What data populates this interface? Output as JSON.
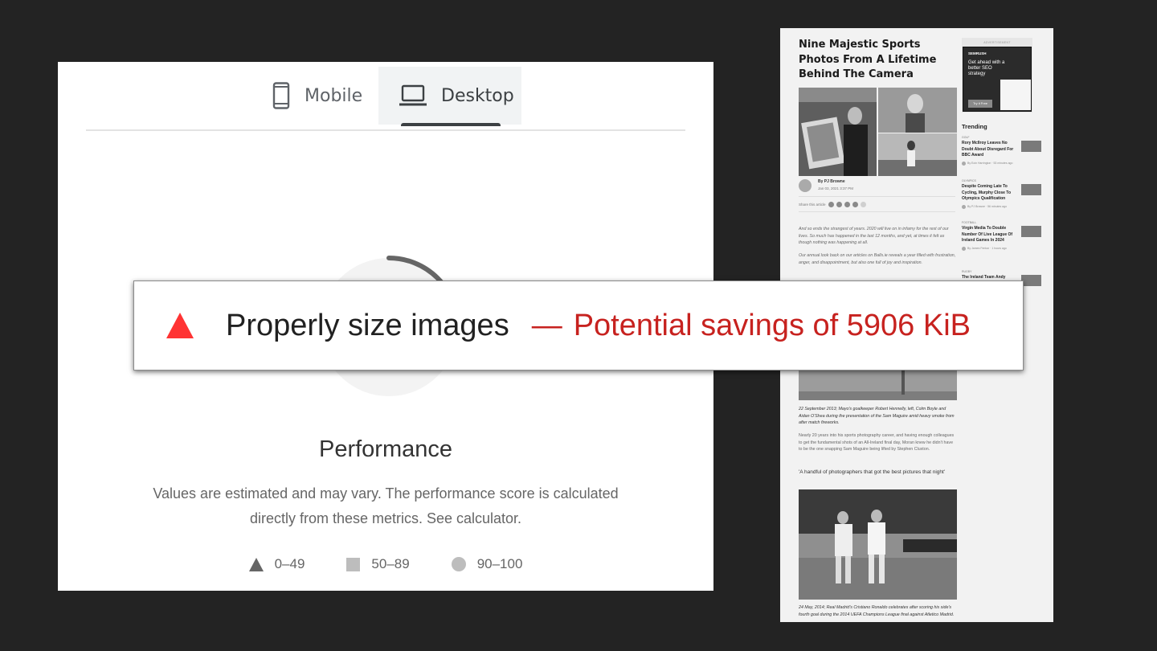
{
  "psi": {
    "tabs": [
      {
        "label": "Mobile",
        "icon": "mobile-phone-icon",
        "selected": false
      },
      {
        "label": "Desktop",
        "icon": "laptop-icon",
        "selected": true
      }
    ],
    "category_title": "Performance",
    "description": "Values are estimated and may vary. The performance score is calculated directly from these metrics. See calculator.",
    "legend": [
      {
        "range": "0–49",
        "shape": "triangle"
      },
      {
        "range": "50–89",
        "shape": "square"
      },
      {
        "range": "90–100",
        "shape": "circle"
      }
    ]
  },
  "callout": {
    "audit": "Properly size images",
    "dash": "—",
    "savings": "Potential savings of 5906 KiB",
    "icon": "warning-triangle-icon",
    "accent": "#c7221f"
  },
  "article": {
    "title": "Nine Majestic Sports Photos From A Lifetime Behind The Camera",
    "author": "By PJ Browne",
    "date": "Jan 03, 2021 3:37 PM",
    "share_label": "Share this article",
    "intro": [
      "And so ends the strangest of years. 2020 will live on in infamy for the rest of our lives. So much has happened in the last 12 months, and yet, at times it felt as though nothing was happening at all.",
      "Our annual look back on our articles on Balls.ie reveals a year filled with frustration, anger, and disappointment, but also one full of joy and inspiration."
    ],
    "caption1": "22 September 2013; Mayo's goalkeeper Robert Hennelly, left, Colm Boyle and Aidan O'Shea during the presentation of the Sam Maguire amid heavy smoke from after match fireworks.",
    "para1": "Nearly 20 years into his sports photography career, and having enough colleagues to get the fundamental shots of an All-Ireland final day, Moran knew he didn't have to be the one snapping Sam Maguire being lifted by Stephen Cluxton.",
    "quote": "'A handful of photographers that got the best pictures that night'",
    "caption2": "24 May, 2014; Real Madrid's Cristiano Ronaldo celebrates after scoring his side's fourth goal during the 2014 UEFA Champions League final against Atletico Madrid."
  },
  "ad": {
    "label": "ADVERTISEMENT",
    "brand": "SEMRUSH",
    "headline": "Get ahead with a better SEO strategy",
    "cta": "Try it Free"
  },
  "trending": {
    "heading": "Trending",
    "items": [
      {
        "category": "GOLF",
        "title": "Rory McIlroy Leaves No Doubt About Disregard For BBC Award",
        "meta": "By Eoin Harrington · 53 minutes ago"
      },
      {
        "category": "OLYMPICS",
        "title": "Despite Coming Late To Cycling, Murphy Close To Olympics Qualification",
        "meta": "By PJ Browne · 56 minutes ago"
      },
      {
        "category": "FOOTBALL",
        "title": "Virgin Media To Double Number Of Live League Of Ireland Games In 2024",
        "meta": "By James Fenton · 1 hours ago"
      },
      {
        "category": "RUGBY",
        "title": "The Ireland Team Andy",
        "meta": ""
      }
    ]
  }
}
